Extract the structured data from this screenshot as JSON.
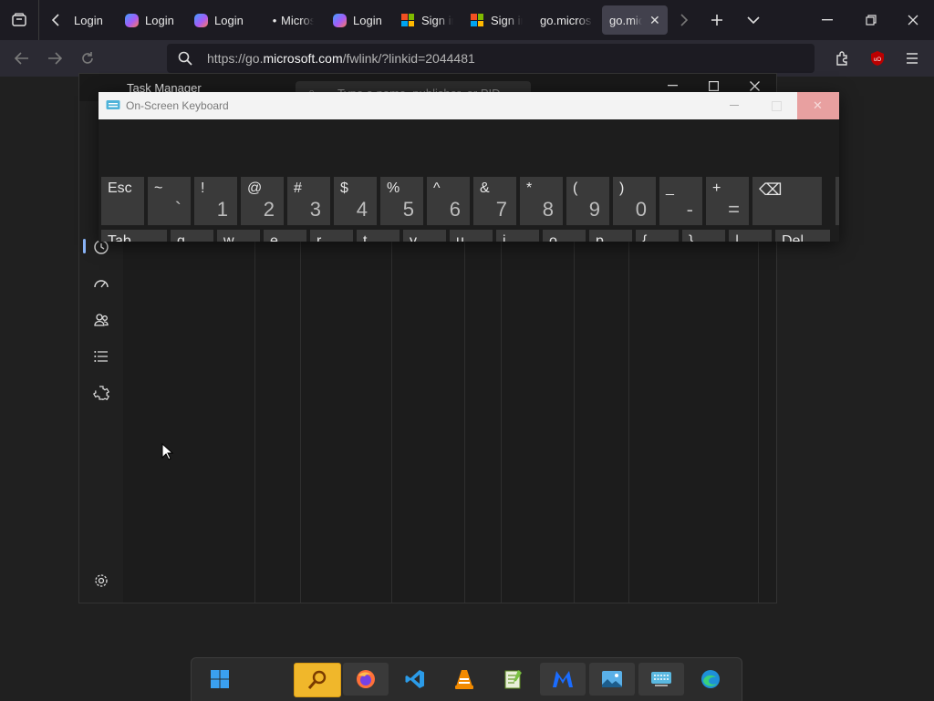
{
  "browser": {
    "tabs": [
      {
        "label": "Login",
        "icon": "none"
      },
      {
        "label": "Login",
        "icon": "copilot-icon"
      },
      {
        "label": "Login",
        "icon": "copilot-icon"
      },
      {
        "label": "Micros",
        "icon": "dot-icon"
      },
      {
        "label": "Login",
        "icon": "copilot-icon"
      },
      {
        "label": "Sign in",
        "icon": "microsoft-logo-icon"
      },
      {
        "label": "Sign in",
        "icon": "microsoft-logo-icon"
      },
      {
        "label": "go.micros",
        "icon": "none"
      },
      {
        "label": "go.micro",
        "icon": "none",
        "active": true
      }
    ],
    "url_host_prefix": "https://go.",
    "url_host": "microsoft.com",
    "url_path": "/fwlink/?linkid=2044481"
  },
  "task_manager": {
    "title": "Task Manager",
    "search_placeholder": "Type a name, publisher, or PID"
  },
  "osk": {
    "title": "On-Screen Keyboard",
    "row1": [
      {
        "top": "Esc",
        "bottom": ""
      },
      {
        "top": "~",
        "bottom": "`"
      },
      {
        "top": "!",
        "bottom": "1"
      },
      {
        "top": "@",
        "bottom": "2"
      },
      {
        "top": "#",
        "bottom": "3"
      },
      {
        "top": "$",
        "bottom": "4"
      },
      {
        "top": "%",
        "bottom": "5"
      },
      {
        "top": "^",
        "bottom": "6"
      },
      {
        "top": "&",
        "bottom": "7"
      },
      {
        "top": "*",
        "bottom": "8"
      },
      {
        "top": "(",
        "bottom": "9"
      },
      {
        "top": ")",
        "bottom": "0"
      },
      {
        "top": "_",
        "bottom": "-"
      },
      {
        "top": "+",
        "bottom": "="
      },
      {
        "top": "⌫",
        "bottom": ""
      }
    ],
    "row2": [
      "Tab",
      "q",
      "w",
      "e",
      "r",
      "t",
      "y",
      "u",
      "i",
      "o",
      "p",
      "{",
      "}",
      "|",
      "Del"
    ]
  },
  "taskbar": {
    "items": [
      "start-button",
      "search-app",
      "firefox",
      "vscode",
      "vlc",
      "notepadpp",
      "malwarebytes",
      "photos",
      "on-screen-keyboard",
      "edge"
    ]
  },
  "colors": {
    "accent_tab": "#42414d",
    "osk_close": "#e8a0a0",
    "taskbar_highlight": "#f0b72b"
  }
}
